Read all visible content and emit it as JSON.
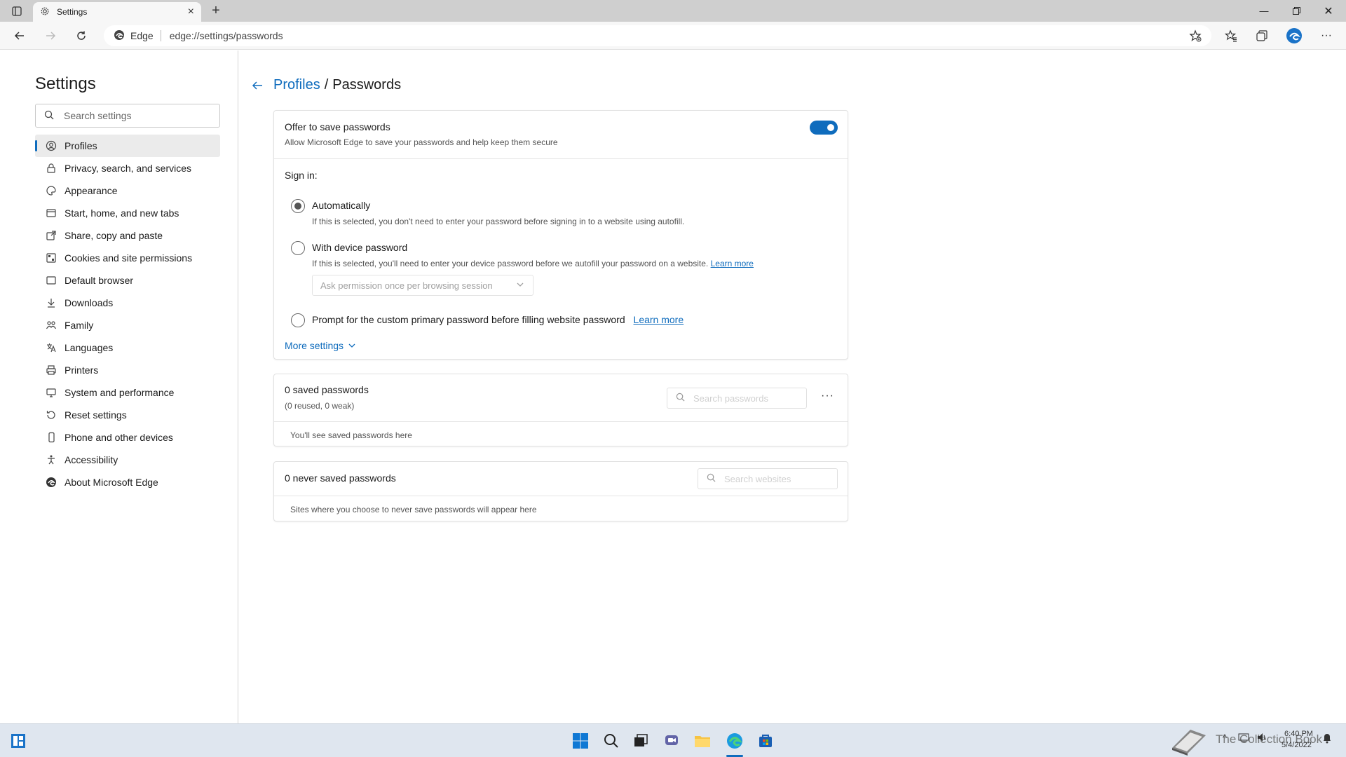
{
  "browser": {
    "tab_title": "Settings",
    "edge_label": "Edge",
    "url": "edge://settings/passwords"
  },
  "sidebar": {
    "title": "Settings",
    "search_placeholder": "Search settings",
    "items": [
      {
        "label": "Profiles",
        "icon": "profile-icon",
        "active": true
      },
      {
        "label": "Privacy, search, and services",
        "icon": "lock-icon"
      },
      {
        "label": "Appearance",
        "icon": "appearance-icon"
      },
      {
        "label": "Start, home, and new tabs",
        "icon": "home-tabs-icon"
      },
      {
        "label": "Share, copy and paste",
        "icon": "share-icon"
      },
      {
        "label": "Cookies and site permissions",
        "icon": "cookies-icon"
      },
      {
        "label": "Default browser",
        "icon": "browser-icon"
      },
      {
        "label": "Downloads",
        "icon": "download-icon"
      },
      {
        "label": "Family",
        "icon": "family-icon"
      },
      {
        "label": "Languages",
        "icon": "language-icon"
      },
      {
        "label": "Printers",
        "icon": "printer-icon"
      },
      {
        "label": "System and performance",
        "icon": "system-icon"
      },
      {
        "label": "Reset settings",
        "icon": "reset-icon"
      },
      {
        "label": "Phone and other devices",
        "icon": "phone-icon"
      },
      {
        "label": "Accessibility",
        "icon": "accessibility-icon"
      },
      {
        "label": "About Microsoft Edge",
        "icon": "edge-icon"
      }
    ]
  },
  "main": {
    "breadcrumb_parent": "Profiles",
    "breadcrumb_sep": "/",
    "breadcrumb_current": "Passwords",
    "offer": {
      "title": "Offer to save passwords",
      "subtitle": "Allow Microsoft Edge to save your passwords and help keep them secure",
      "enabled": true
    },
    "signin": {
      "heading": "Sign in:",
      "auto_title": "Automatically",
      "auto_desc": "If this is selected, you don't need to enter your password before signing in to a website using autofill.",
      "device_title": "With device password",
      "device_desc": "If this is selected, you'll need to enter your device password before we autofill your password on a website.",
      "device_learn_more": "Learn more",
      "device_dropdown": "Ask permission once per browsing session",
      "custom_title": "Prompt for the custom primary password before filling website password",
      "custom_learn_more": "Learn more",
      "selected": "Automatically"
    },
    "more_settings": "More settings",
    "saved": {
      "title": "0 saved passwords",
      "subtitle": "(0 reused, 0 weak)",
      "search_placeholder": "Search passwords",
      "empty": "You'll see saved passwords here"
    },
    "never_saved": {
      "title": "0 never saved passwords",
      "search_placeholder": "Search websites",
      "empty": "Sites where you choose to never save passwords will appear here"
    }
  },
  "taskbar": {
    "time": "6:40 PM",
    "date": "5/4/2022",
    "watermark": "The Collection Book"
  },
  "colors": {
    "accent": "#0f6cbd",
    "taskbar": "#dfe6ef"
  }
}
